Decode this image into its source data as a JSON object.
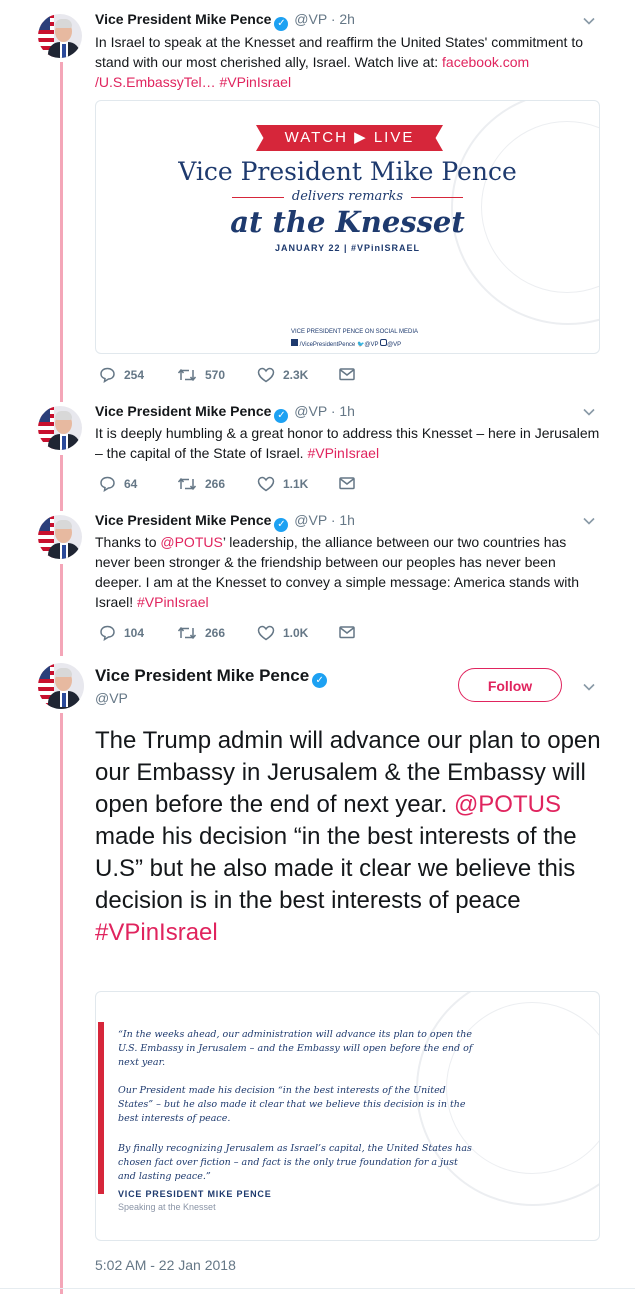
{
  "author": {
    "name": "Vice President Mike Pence",
    "handle": "@VP",
    "verified": true
  },
  "tweets": [
    {
      "time": "· 2h",
      "text_plain": "In Israel to speak at the Knesset and reaffirm the United States' commitment to stand with our most cherished ally, Israel. Watch live at: ",
      "link": "facebook.com /U.S.EmbassyTel…",
      "hashtag": "#VPinIsrael",
      "card": {
        "banner": "WATCH ▶ LIVE",
        "title": "Vice President Mike Pence",
        "subtitle": "delivers remarks",
        "headline": "at the Knesset",
        "dateline": "JANUARY 22 | #VPinISRAEL",
        "social_heading": "VICE PRESIDENT PENCE ON SOCIAL MEDIA",
        "social_fb": "/VicePresidentPence",
        "social_tw": "@VP",
        "social_ig": "@VP"
      },
      "replies": "254",
      "retweets": "570",
      "likes": "2.3K"
    },
    {
      "time": "· 1h",
      "text_plain": "It is deeply humbling & a great honor to address this Knesset – here in Jerusalem – the capital of the State of Israel. ",
      "hashtag": "#VPinIsrael",
      "replies": "64",
      "retweets": "266",
      "likes": "1.1K"
    },
    {
      "time": "· 1h",
      "text_prefix": "Thanks to ",
      "mention": "@POTUS",
      "text_plain": "’ leadership, the alliance between our two countries has never been stronger & the friendship between our peoples has never been deeper. I am at the Knesset to convey a simple message: America stands with Israel! ",
      "hashtag": "#VPinIsrael",
      "replies": "104",
      "retweets": "266",
      "likes": "1.0K"
    }
  ],
  "main_tweet": {
    "follow_label": "Follow",
    "text_before": "The Trump admin will advance our plan to open our Embassy in Jerusalem & the Embassy will open before the end of next year. ",
    "mention": "@POTUS",
    "text_after": " made his decision “in the best interests of the U.S” but he also made it clear we believe this decision is in the best interests of peace ",
    "hashtag": "#VPinIsrael",
    "quote_card": {
      "p1": "“In the weeks ahead, our administration will advance its plan to open the U.S. Embassy in Jerusalem – and the Embassy will open before the end of next year.",
      "p2": "Our President made his decision “in the best interests of the United States” – but he also made it clear that we believe this decision is in the best interests of peace.",
      "p3": "By finally recognizing Jerusalem as Israel’s capital, the United States has chosen fact over fiction – and fact is the only true foundation for a just and lasting peace.”",
      "attribution": "VICE PRESIDENT MIKE PENCE",
      "context": "Speaking at the Knesset"
    },
    "timestamp": "5:02 AM - 22 Jan 2018"
  },
  "colors": {
    "accent": "#e0245e",
    "thread_line": "#f4a6b8",
    "banner_red": "#d6263a",
    "card_navy": "#1e3a6e",
    "muted": "#657786",
    "verified": "#1da1f2"
  },
  "icons": [
    "reply-icon",
    "retweet-icon",
    "like-icon",
    "dm-icon",
    "chevron-down-icon",
    "verified-badge-icon"
  ]
}
